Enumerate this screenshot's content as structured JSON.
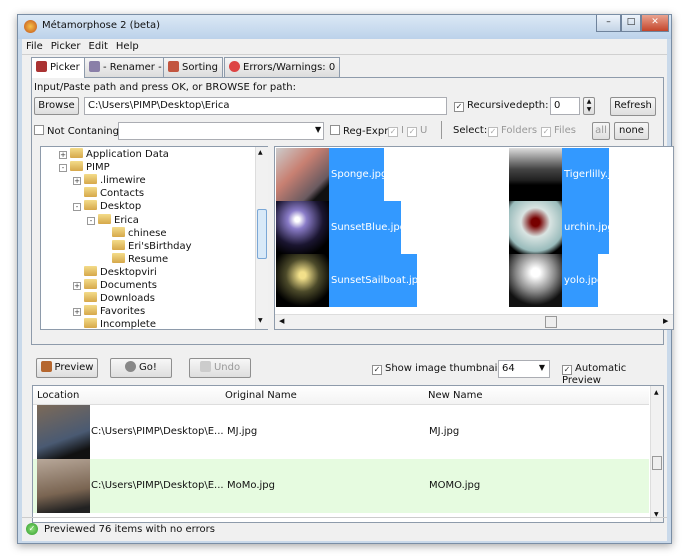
{
  "window": {
    "title": "Métamorphose 2 (beta)",
    "controls": [
      "minimize",
      "maximize",
      "close"
    ]
  },
  "menu": [
    "File",
    "Picker",
    "Edit",
    "Help"
  ],
  "tabs": [
    "Picker",
    "- Renamer -",
    "Sorting",
    "Errors/Warnings: 0"
  ],
  "picker": {
    "instruction": "Input/Paste path and press OK, or BROWSE for path:",
    "browse": "Browse",
    "path": "C:\\Users\\PIMP\\Desktop\\Erica",
    "recursive": "Recursive",
    "depth_label": "depth:",
    "depth": "0",
    "refresh": "Refresh",
    "not_containing": "Not Contaning:",
    "not_containing_value": "",
    "regexpr": "Reg-Expr",
    "i": "I",
    "u": "U",
    "select": "Select:",
    "folders": "Folders",
    "files": "Files",
    "all": "all",
    "none": "none"
  },
  "tree": [
    {
      "label": "Application Data",
      "level": 0,
      "toggle": "+"
    },
    {
      "label": "PIMP",
      "level": 0,
      "toggle": "-"
    },
    {
      "label": ".limewire",
      "level": 1,
      "toggle": "+"
    },
    {
      "label": "Contacts",
      "level": 1,
      "toggle": ""
    },
    {
      "label": "Desktop",
      "level": 1,
      "toggle": "-"
    },
    {
      "label": "Erica",
      "level": 2,
      "toggle": "-"
    },
    {
      "label": "chinese",
      "level": 3,
      "toggle": ""
    },
    {
      "label": "Eri'sBirthday",
      "level": 3,
      "toggle": ""
    },
    {
      "label": "Resume",
      "level": 3,
      "toggle": ""
    },
    {
      "label": "Desktopviri",
      "level": 1,
      "toggle": ""
    },
    {
      "label": "Documents",
      "level": 1,
      "toggle": "+"
    },
    {
      "label": "Downloads",
      "level": 1,
      "toggle": ""
    },
    {
      "label": "Favorites",
      "level": 1,
      "toggle": "+"
    },
    {
      "label": "Incomplete",
      "level": 1,
      "toggle": ""
    }
  ],
  "images": [
    {
      "name": "Sponge.jpg",
      "col": 0
    },
    {
      "name": "SunsetBlue.jpg",
      "col": 0
    },
    {
      "name": "SunsetSailboat.jpg",
      "col": 0
    },
    {
      "name": "Tigerlilly.jpg",
      "col": 1
    },
    {
      "name": "urchin.jpg",
      "col": 1
    },
    {
      "name": "yolo.jpg",
      "col": 1
    }
  ],
  "toolbar": {
    "preview": "Preview",
    "go": "Go!",
    "undo": "Undo",
    "show_thumbs": "Show image thumbnails",
    "thumb_size": "64",
    "auto_preview": "Automatic Preview"
  },
  "table": {
    "headers": [
      "Location",
      "Original Name",
      "New Name"
    ],
    "rows": [
      {
        "location": "C:\\Users\\PIMP\\Desktop\\E...",
        "original": "MJ.jpg",
        "new": "MJ.jpg"
      },
      {
        "location": "C:\\Users\\PIMP\\Desktop\\E...",
        "original": "MoMo.jpg",
        "new": "MOMO.jpg"
      }
    ]
  },
  "status": "Previewed 76 items with no errors"
}
